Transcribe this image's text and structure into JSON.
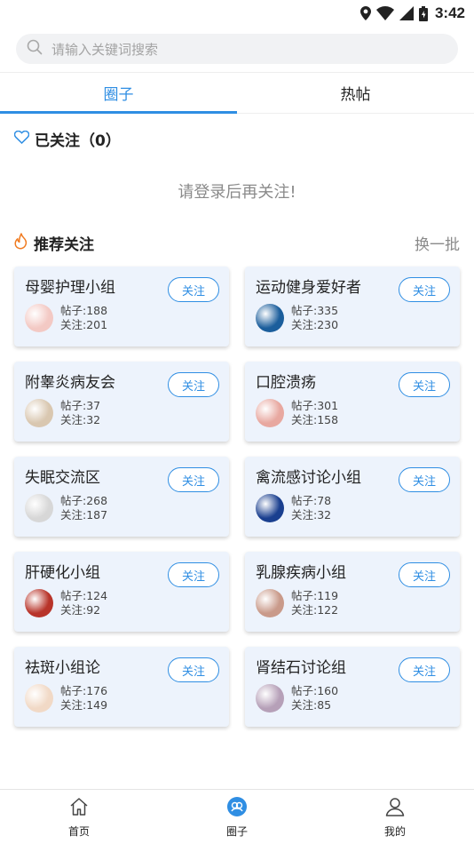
{
  "status_bar": {
    "time": "3:42"
  },
  "search": {
    "placeholder": "请输入关键词搜索"
  },
  "tabs": [
    {
      "label": "圈子",
      "active": true
    },
    {
      "label": "热帖",
      "active": false
    }
  ],
  "followed": {
    "title": "已关注（0）",
    "empty_hint": "请登录后再关注!"
  },
  "recommend": {
    "title": "推荐关注",
    "refresh": "换一批"
  },
  "follow_label": "关注",
  "groups": [
    {
      "name": "母婴护理小组",
      "posts": "帖子:188",
      "follows": "关注:201",
      "avatar_color": "#f3c9c4"
    },
    {
      "name": "运动健身爱好者",
      "posts": "帖子:335",
      "follows": "关注:230",
      "avatar_color": "#1b5e9c"
    },
    {
      "name": "附睾炎病友会",
      "posts": "帖子:37",
      "follows": "关注:32",
      "avatar_color": "#d9c7b0"
    },
    {
      "name": "口腔溃疡",
      "posts": "帖子:301",
      "follows": "关注:158",
      "avatar_color": "#e8a8a0"
    },
    {
      "name": "失眠交流区",
      "posts": "帖子:268",
      "follows": "关注:187",
      "avatar_color": "#d7d7d7"
    },
    {
      "name": "禽流感讨论小组",
      "posts": "帖子:78",
      "follows": "关注:32",
      "avatar_color": "#1a3f8f"
    },
    {
      "name": "肝硬化小组",
      "posts": "帖子:124",
      "follows": "关注:92",
      "avatar_color": "#b8342a"
    },
    {
      "name": "乳腺疾病小组",
      "posts": "帖子:119",
      "follows": "关注:122",
      "avatar_color": "#c99a8a"
    },
    {
      "name": "祛斑小组论",
      "posts": "帖子:176",
      "follows": "关注:149",
      "avatar_color": "#f1d9c6"
    },
    {
      "name": "肾结石讨论组",
      "posts": "帖子:160",
      "follows": "关注:85",
      "avatar_color": "#b6a0b8"
    }
  ],
  "bottom_nav": [
    {
      "label": "首页",
      "icon": "home-icon",
      "active": false
    },
    {
      "label": "圈子",
      "icon": "circle-group-icon",
      "active": true
    },
    {
      "label": "我的",
      "icon": "user-icon",
      "active": false
    }
  ],
  "colors": {
    "accent": "#2f8ee3",
    "card_bg": "#edf3fc",
    "flame": "#f07a1f"
  }
}
